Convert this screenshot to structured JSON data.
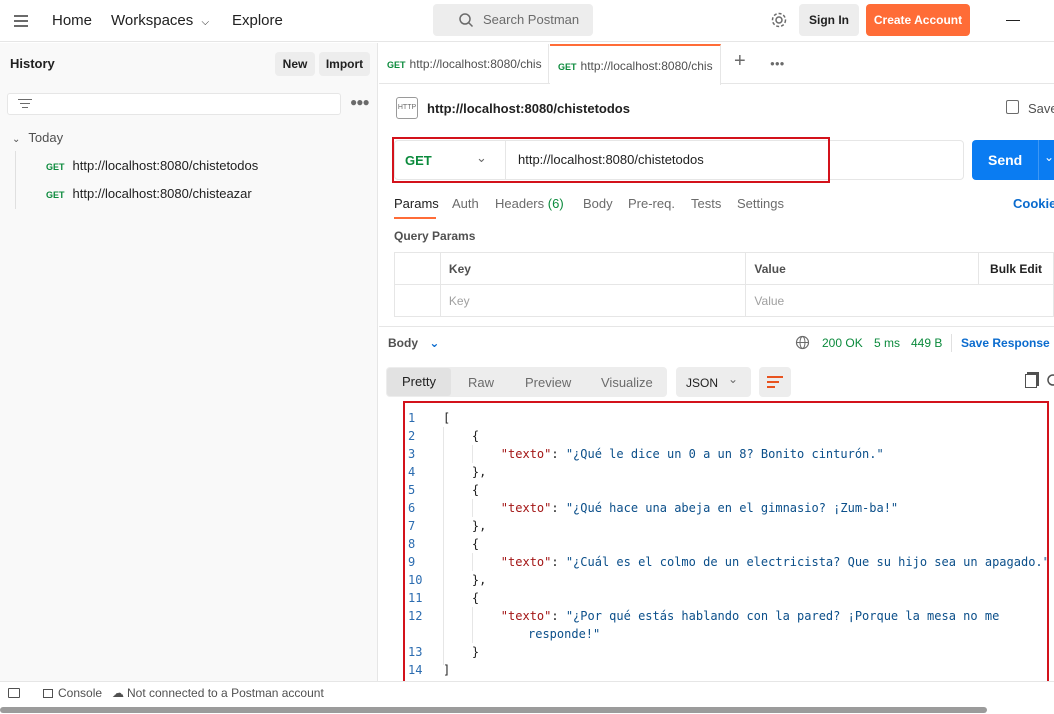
{
  "topbar": {
    "home": "Home",
    "workspaces": "Workspaces",
    "explore": "Explore",
    "search_placeholder": "Search Postman",
    "sign_in": "Sign In",
    "create_account": "Create Account"
  },
  "sidebar": {
    "title": "History",
    "new_label": "New",
    "import_label": "Import",
    "group": "Today",
    "items": [
      {
        "method": "GET",
        "url": "http://localhost:8080/chistetodos"
      },
      {
        "method": "GET",
        "url": "http://localhost:8080/chisteazar"
      }
    ]
  },
  "tabs": [
    {
      "method": "GET",
      "url": "http://localhost:8080/chis"
    },
    {
      "method": "GET",
      "url": "http://localhost:8080/chis"
    }
  ],
  "request": {
    "title": "http://localhost:8080/chistetodos",
    "save": "Save",
    "method": "GET",
    "url": "http://localhost:8080/chistetodos",
    "send": "Send",
    "subtabs": [
      "Params",
      "Auth",
      "Headers",
      "Body",
      "Pre-req.",
      "Tests",
      "Settings"
    ],
    "headers_count": "(6)",
    "cookies": "Cookie",
    "query_params_title": "Query Params",
    "col_key": "Key",
    "col_value": "Value",
    "bulk_edit": "Bulk Edit",
    "key_placeholder": "Key",
    "value_placeholder": "Value"
  },
  "response": {
    "body_label": "Body",
    "status": "200 OK",
    "time": "5 ms",
    "size": "449 B",
    "save_response": "Save Response",
    "view_tabs": [
      "Pretty",
      "Raw",
      "Preview",
      "Visualize"
    ],
    "format": "JSON",
    "lines": [
      {
        "n": "1",
        "t": "["
      },
      {
        "n": "2",
        "t": "    {"
      },
      {
        "n": "3",
        "k": "\"texto\"",
        "v": "\"¿Qué le dice un 0 a un 8? Bonito cinturón.\""
      },
      {
        "n": "4",
        "t": "    },"
      },
      {
        "n": "5",
        "t": "    {"
      },
      {
        "n": "6",
        "k": "\"texto\"",
        "v": "\"¿Qué hace una abeja en el gimnasio? ¡Zum-ba!\""
      },
      {
        "n": "7",
        "t": "    },"
      },
      {
        "n": "8",
        "t": "    {"
      },
      {
        "n": "9",
        "k": "\"texto\"",
        "v": "\"¿Cuál es el colmo de un electricista? Que su hijo sea un apagado.\""
      },
      {
        "n": "10",
        "t": "    },"
      },
      {
        "n": "11",
        "t": "    {"
      },
      {
        "n": "12",
        "k": "\"texto\"",
        "v": "\"¿Por qué estás hablando con la pared? ¡Porque la mesa no me"
      },
      {
        "n": "",
        "v": "responde!\""
      },
      {
        "n": "13",
        "t": "    }"
      },
      {
        "n": "14",
        "t": "]"
      }
    ]
  },
  "statusbar": {
    "console": "Console",
    "not_connected": "Not connected to a Postman account"
  },
  "colors": {
    "accent": "#ff6c37",
    "send": "#0a7cf2",
    "get": "#0b8a3c",
    "highlight": "#d3121b"
  }
}
